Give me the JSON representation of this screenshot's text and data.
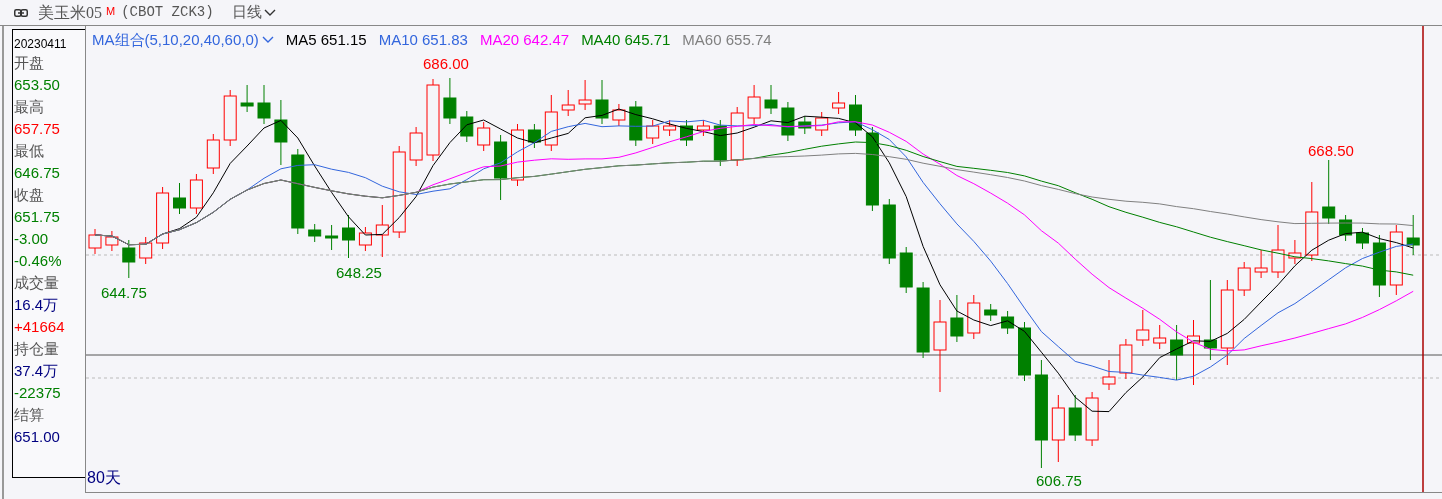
{
  "title_bar": {
    "symbol": "美玉米05",
    "marker": "M",
    "code": "(CBOT ZCK3)",
    "period": "日线"
  },
  "info_panel": {
    "date": "20230411",
    "rows": [
      {
        "kind": "label",
        "text": "开盘"
      },
      {
        "kind": "value",
        "text": "653.50",
        "color": "#008000"
      },
      {
        "kind": "label",
        "text": "最高"
      },
      {
        "kind": "value",
        "text": "657.75",
        "color": "#ff0000"
      },
      {
        "kind": "label",
        "text": "最低"
      },
      {
        "kind": "value",
        "text": "646.75",
        "color": "#008000"
      },
      {
        "kind": "label",
        "text": "收盘"
      },
      {
        "kind": "value",
        "text": "651.75",
        "color": "#008000"
      },
      {
        "kind": "value",
        "text": "-3.00",
        "color": "#008000"
      },
      {
        "kind": "value",
        "text": "-0.46%",
        "color": "#008000"
      },
      {
        "kind": "label",
        "text": "成交量"
      },
      {
        "kind": "value",
        "text": "16.4万",
        "color": "#000080"
      },
      {
        "kind": "value",
        "text": "+41664",
        "color": "#ff0000"
      },
      {
        "kind": "label",
        "text": "持仓量"
      },
      {
        "kind": "value",
        "text": "37.4万",
        "color": "#000080"
      },
      {
        "kind": "value",
        "text": "-22375",
        "color": "#008000"
      },
      {
        "kind": "label",
        "text": "结算"
      },
      {
        "kind": "value",
        "text": "651.00",
        "color": "#000080"
      }
    ]
  },
  "chart": {
    "indicator": "MA组合(5,10,20,40,60,0)",
    "ma_lines": [
      {
        "label": "MA5 651.15",
        "color": "#000000"
      },
      {
        "label": "MA10 651.83",
        "color": "#3366dd"
      },
      {
        "label": "MA20 642.47",
        "color": "#ff00ff"
      },
      {
        "label": "MA40 645.71",
        "color": "#008000"
      },
      {
        "label": "MA60 655.74",
        "color": "#808080"
      }
    ],
    "price_labels": [
      {
        "text": "686.00",
        "color": "#ff0000"
      },
      {
        "text": "644.75",
        "color": "#008000"
      },
      {
        "text": "648.25",
        "color": "#008000"
      },
      {
        "text": "606.75",
        "color": "#008000"
      },
      {
        "text": "668.50",
        "color": "#ff0000"
      }
    ],
    "range": "80天"
  }
}
